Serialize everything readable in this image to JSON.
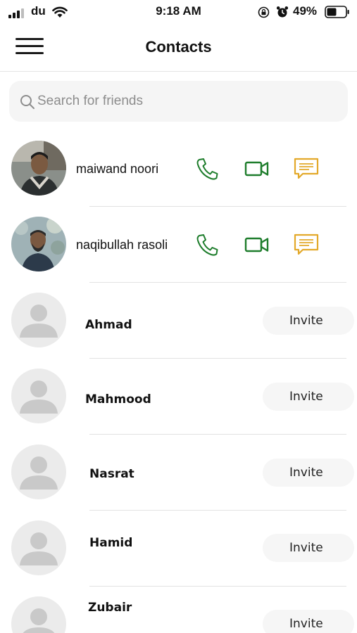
{
  "status_bar": {
    "carrier": "du",
    "time": "9:18 AM",
    "battery": "49%"
  },
  "header": {
    "title": "Contacts"
  },
  "search": {
    "placeholder": "Search for friends"
  },
  "contacts": [
    {
      "name": "maiwand noori",
      "on_app": true
    },
    {
      "name": "naqibullah rasoli",
      "on_app": true
    },
    {
      "name": "Ahmad",
      "invite_label": "Invite"
    },
    {
      "name": "Mahmood",
      "invite_label": "Invite"
    },
    {
      "name": "Nasrat",
      "invite_label": "Invite"
    },
    {
      "name": "Hamid",
      "invite_label": "Invite"
    },
    {
      "name": "Zubair",
      "invite_label": "Invite"
    }
  ],
  "colors": {
    "call": "#1e7d2c",
    "video": "#1e7d2c",
    "message": "#e3a92a",
    "avatar_placeholder_bg": "#ebebeb",
    "avatar_placeholder_fg": "#c9c9c9"
  },
  "icons": {
    "call": "phone-icon",
    "video": "video-camera-icon",
    "message": "chat-bubble-icon",
    "menu": "hamburger-menu-icon",
    "search": "search-icon"
  }
}
